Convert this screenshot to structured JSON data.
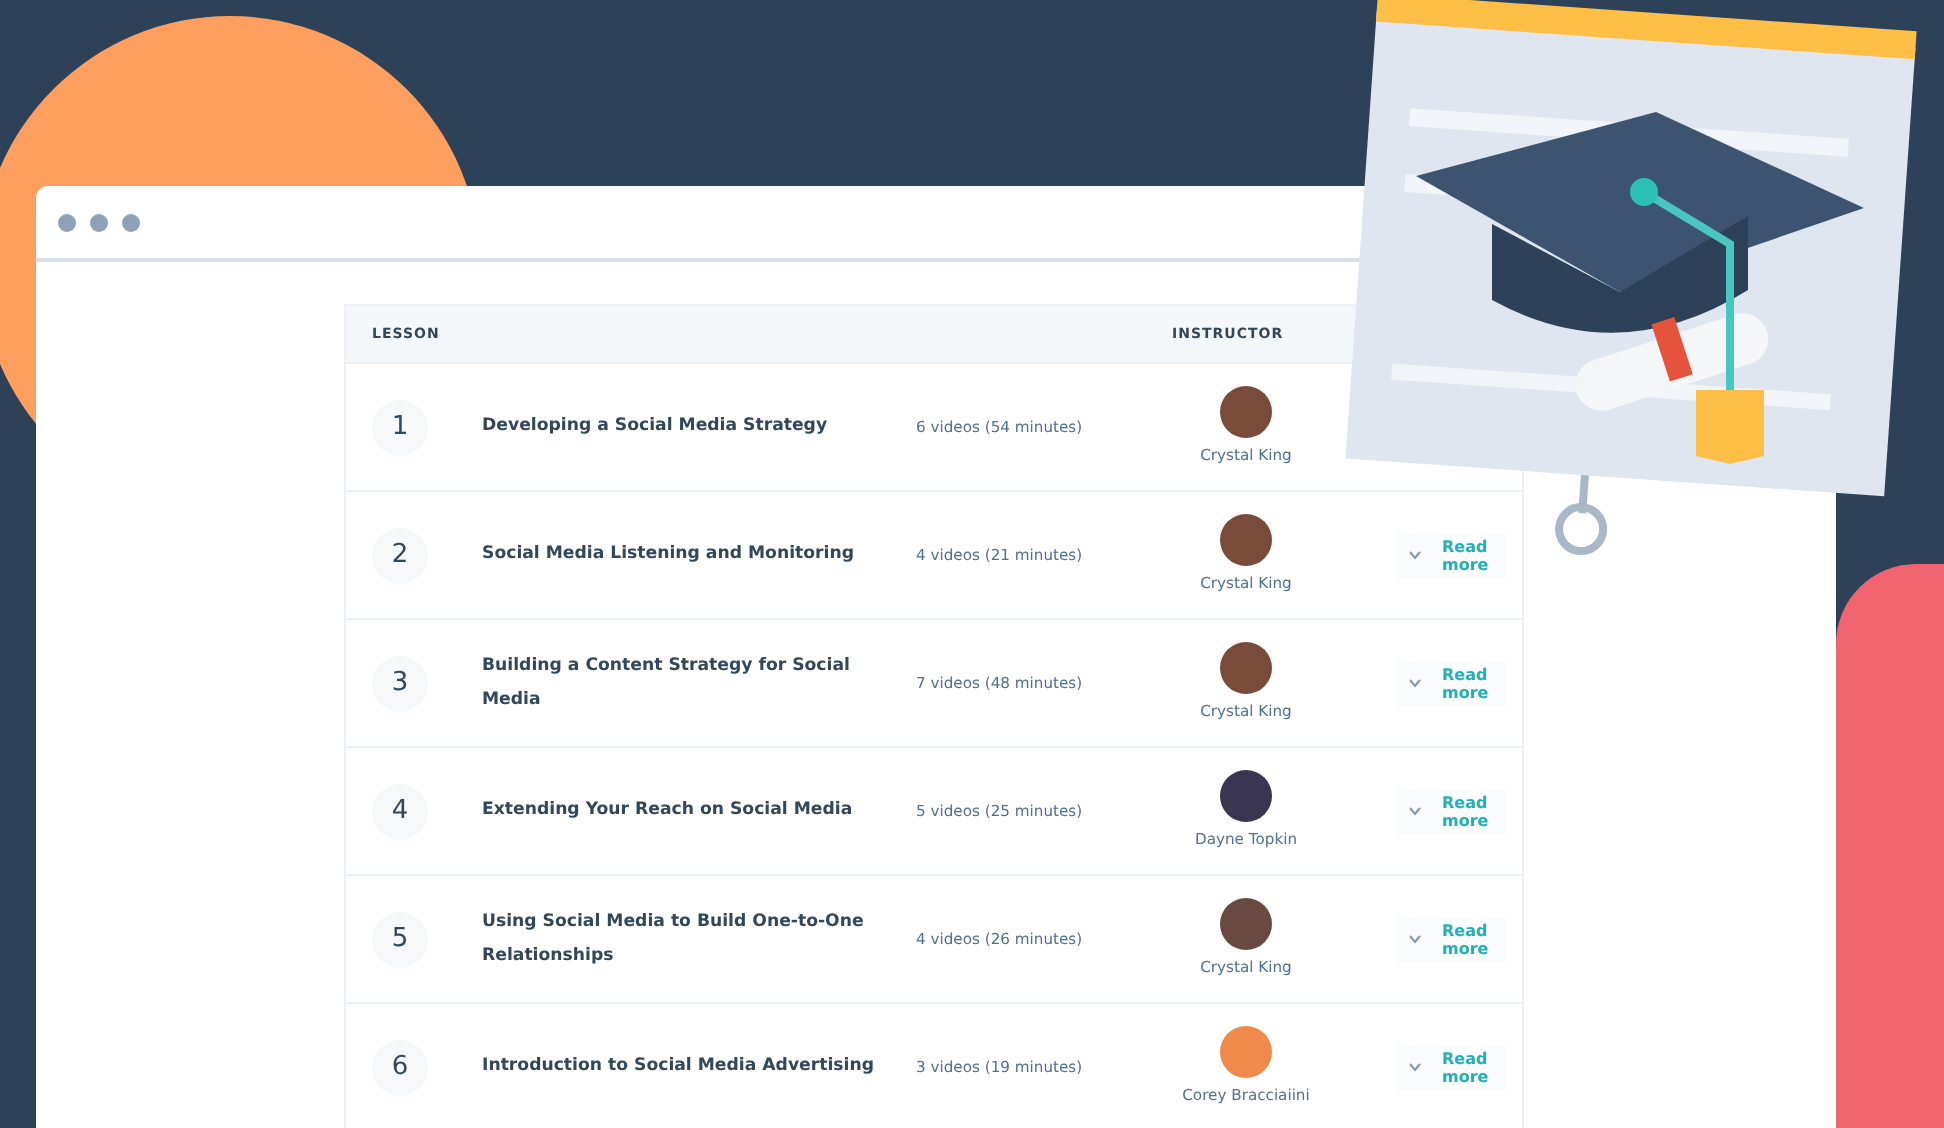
{
  "columns": {
    "lesson": "LESSON",
    "instructor": "INSTRUCTOR"
  },
  "lessons": [
    {
      "number": "1",
      "title": "Developing a Social Media Strategy",
      "videos": "6 videos (54 minutes)",
      "instructor": "Crystal King",
      "color": "#7a4a3a"
    },
    {
      "number": "2",
      "title": "Social Media Listening and Monitoring",
      "videos": "4 videos (21 minutes)",
      "instructor": "Crystal King",
      "color": "#7a4a3a",
      "read_more": "Read more"
    },
    {
      "number": "3",
      "title": "Building a Content Strategy for Social Media",
      "videos": "7 videos (48 minutes)",
      "instructor": "Crystal King",
      "color": "#7a4a3a",
      "read_more": "Read more"
    },
    {
      "number": "4",
      "title": "Extending Your Reach on Social Media",
      "videos": "5 videos (25 minutes)",
      "instructor": "Dayne Topkin",
      "color": "#3a3550",
      "read_more": "Read more"
    },
    {
      "number": "5",
      "title": "Using Social Media to Build One-to-One Relationships",
      "videos": "4 videos (26 minutes)",
      "instructor": "Crystal King",
      "color": "#6a4a40",
      "read_more": "Read more"
    },
    {
      "number": "6",
      "title": "Introduction to Social Media Advertising",
      "videos": "3 videos (19 minutes)",
      "instructor": "Corey Bracciaiini",
      "color": "#f08a4b",
      "read_more": "Read more"
    }
  ]
}
